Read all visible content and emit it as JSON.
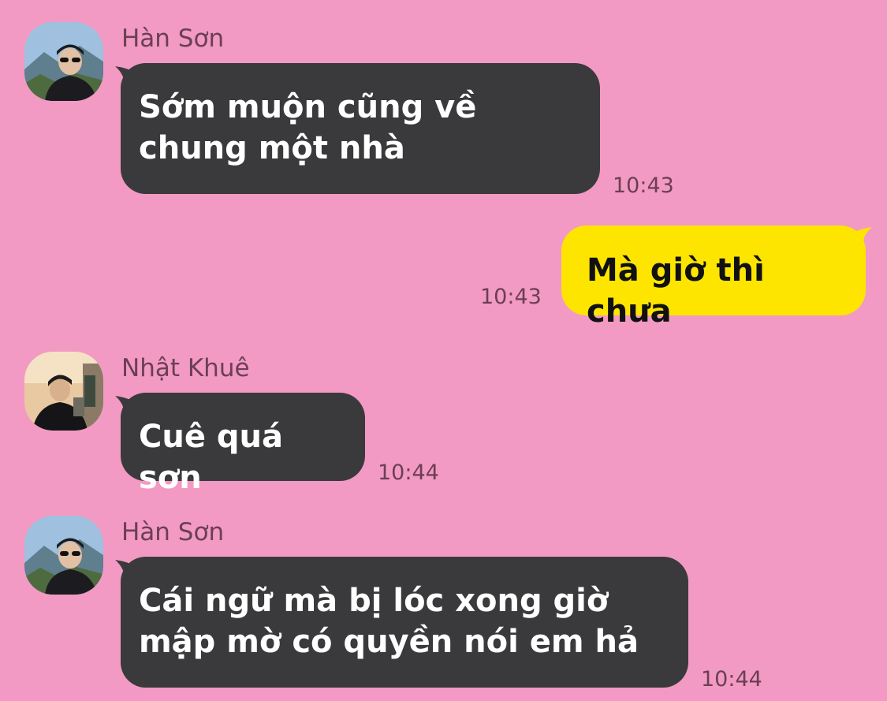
{
  "colors": {
    "background": "#F29AC3",
    "incoming_bubble": "#3A3A3C",
    "outgoing_bubble": "#FEE500",
    "meta_text": "#6B3F55"
  },
  "messages": [
    {
      "sender": "Hàn Sơn",
      "avatar_icon": "user-avatar-icon",
      "text": "Sớm muộn cũng về chung một nhà",
      "time": "10:43"
    },
    {
      "text": "Mà giờ thì chưa",
      "time": "10:43"
    },
    {
      "sender": "Nhật Khuê",
      "avatar_icon": "user-avatar-icon",
      "text": "Cuê quá sơn",
      "time": "10:44"
    },
    {
      "sender": "Hàn Sơn",
      "avatar_icon": "user-avatar-icon",
      "text": "Cái ngữ mà bị lóc xong giờ mập mờ có quyền nói em hả",
      "time": "10:44"
    }
  ]
}
